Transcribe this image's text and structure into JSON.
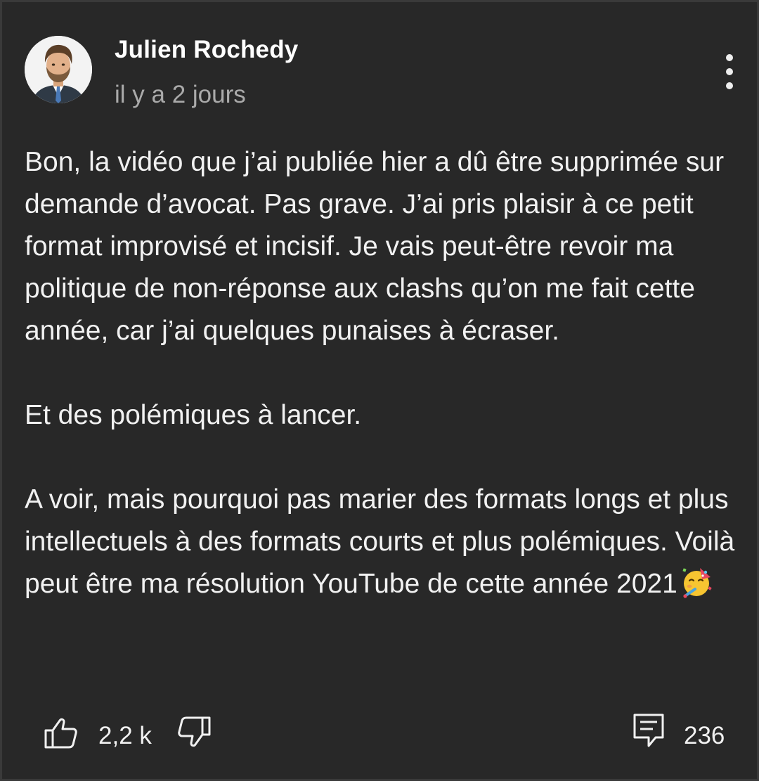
{
  "comment": {
    "author": "Julien Rochedy",
    "timestamp": "il y a 2 jours",
    "paragraphs": [
      "Bon, la vidéo que j’ai publiée hier a dû être supprimée sur demande d’avocat. Pas grave. J’ai pris plaisir à ce petit format improvisé et incisif. Je vais peut-être revoir ma politique de non-réponse aux clashs qu’on me fait cette année, car j’ai quelques punaises à écraser.",
      "Et des polémiques à lancer.",
      "A voir, mais pourquoi pas marier des formats longs et plus intellectuels à des formats courts et plus polémiques. Voilà peut être ma résolution YouTube de cette année 2021"
    ],
    "emoji": "partying-face-emoji",
    "likes": "2,2 k",
    "replies": "236"
  },
  "icons": {
    "menu": "more-vertical-icon",
    "like": "thumbs-up-icon",
    "dislike": "thumbs-down-icon",
    "reply": "comment-icon"
  },
  "colors": {
    "background": "#282828",
    "text": "#f1f1f1",
    "secondary_text": "#aaaaaa"
  }
}
